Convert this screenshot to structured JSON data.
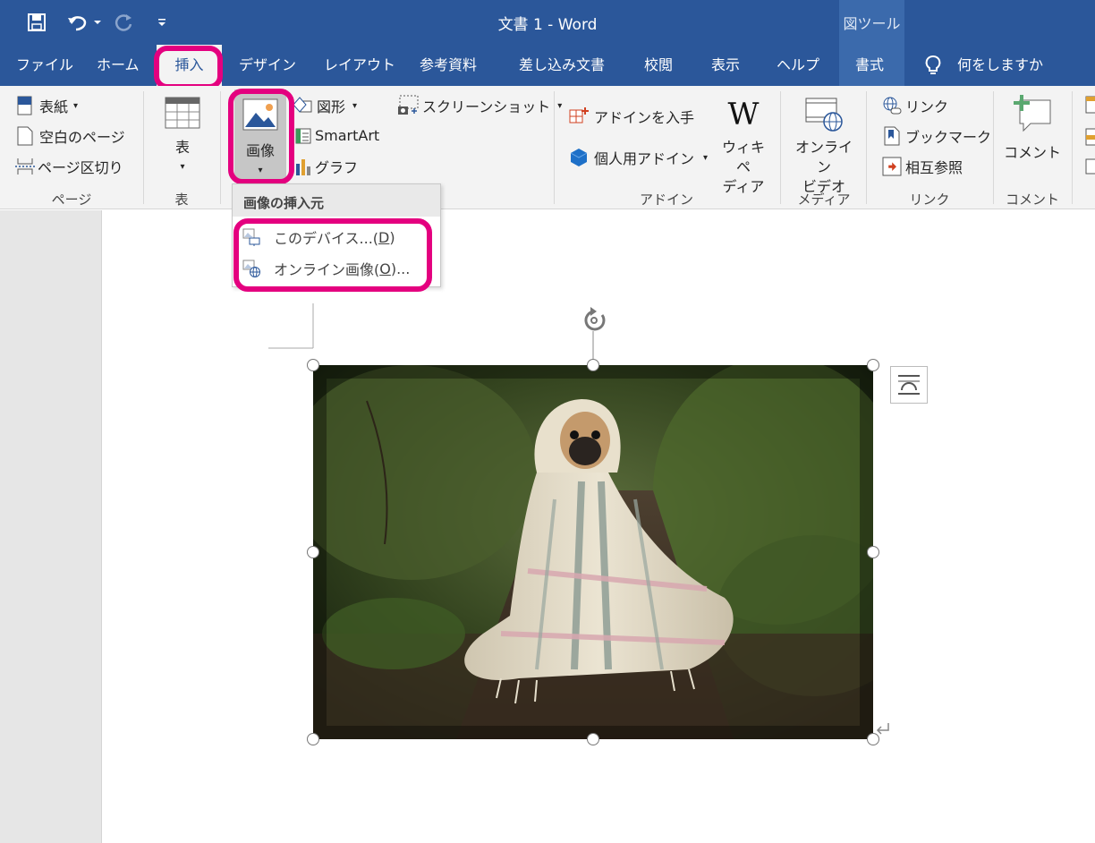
{
  "titlebar": {
    "doc_title": "文書 1  -  Word",
    "contextual_label": "図ツール"
  },
  "tabs": [
    {
      "label": "ファイル"
    },
    {
      "label": "ホーム"
    },
    {
      "label": "挿入",
      "active": true
    },
    {
      "label": "デザイン"
    },
    {
      "label": "レイアウト"
    },
    {
      "label": "参考資料"
    },
    {
      "label": "差し込み文書"
    },
    {
      "label": "校閲"
    },
    {
      "label": "表示"
    },
    {
      "label": "ヘルプ"
    },
    {
      "label": "書式"
    }
  ],
  "tell_me": "何をしますか",
  "ribbon": {
    "pages": {
      "cover": "表紙",
      "blank": "空白のページ",
      "break": "ページ区切り",
      "group": "ページ"
    },
    "table": {
      "button": "表",
      "group": "表"
    },
    "illustrations": {
      "picture": "画像",
      "shapes": "図形",
      "smartart": "SmartArt",
      "chart": "グラフ",
      "screenshot": "スクリーンショット"
    },
    "addins": {
      "get": "アドインを入手",
      "my": "個人用アドイン",
      "wiki_line1": "ウィキペ",
      "wiki_line2": "ディア",
      "group": "アドイン"
    },
    "media": {
      "line1": "オンライン",
      "line2": "ビデオ",
      "group": "メディア"
    },
    "links": {
      "link": "リンク",
      "bookmark": "ブックマーク",
      "crossref": "相互参照",
      "group": "リンク"
    },
    "comments": {
      "button": "コメント",
      "group": "コメント"
    }
  },
  "dropdown": {
    "header": "画像の挿入元",
    "items": [
      {
        "label": "このデバイス...(",
        "key": "D",
        "end": ")"
      },
      {
        "label": "オンライン画像(",
        "key": "O",
        "end": ")..."
      }
    ]
  },
  "colors": {
    "accent": "#2b579a",
    "highlight": "#e4007f"
  }
}
